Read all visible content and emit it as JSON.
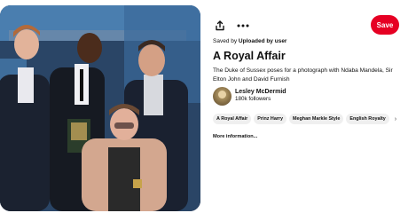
{
  "pin": {
    "image_alt": "Prince Harry, Ndaba Mandela, Elton John and David Furnish photo",
    "saved_by_prefix": "Saved by",
    "saved_by_user": "Uploaded by user",
    "title": "A Royal Affair",
    "description": "The Duke of Sussex poses for a photograph with Ndaba Mandela, Sir Elton John and David Furnish"
  },
  "actions": {
    "share_icon": "share-icon",
    "more_icon": "more-options-icon",
    "save_label": "Save",
    "save_color": "#e60023"
  },
  "author": {
    "name": "Lesley McDermid",
    "followers": "180k followers"
  },
  "tags": [
    "A Royal Affair",
    "Prinz Harry",
    "Meghan Markle Style",
    "English Royalty"
  ],
  "tags_more_icon": "chevron-right-icon",
  "more_info_label": "More information..."
}
